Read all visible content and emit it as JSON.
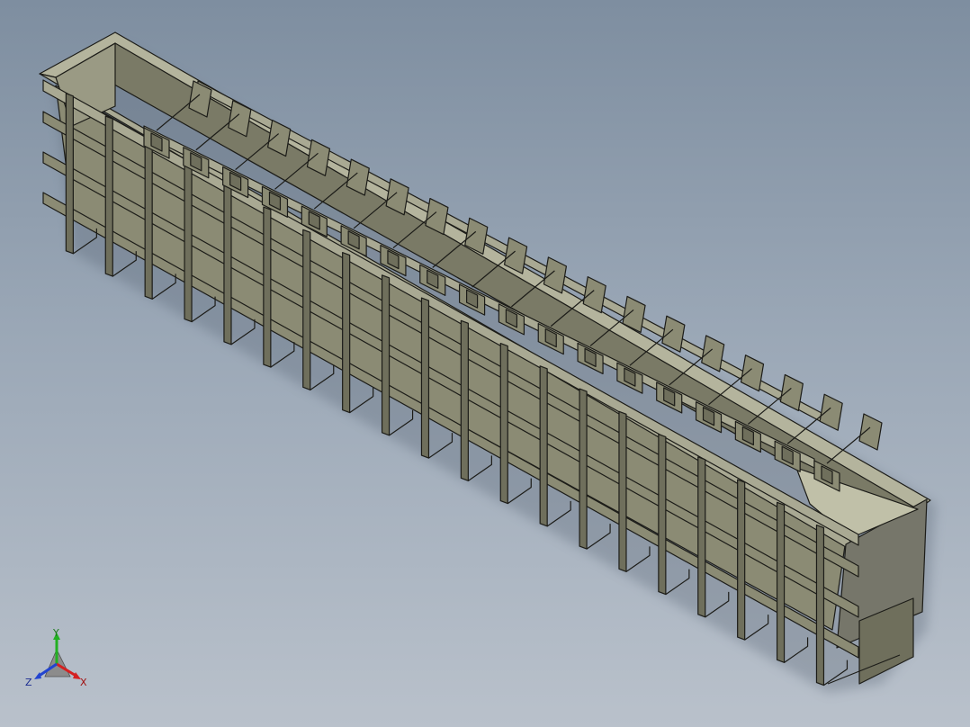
{
  "viewport": {
    "background_top": "#7e8ea0",
    "background_bottom": "#b9c1cb",
    "model_colors": {
      "face_light": "#a9a993",
      "face_mid": "#8b8b74",
      "face_dark": "#6f6f5c",
      "edge": "#1c1c18"
    }
  },
  "triad": {
    "x_label": "X",
    "y_label": "Y",
    "z_label": "Z",
    "x_color": "#d42020",
    "y_color": "#22b022",
    "z_color": "#2244d0"
  }
}
